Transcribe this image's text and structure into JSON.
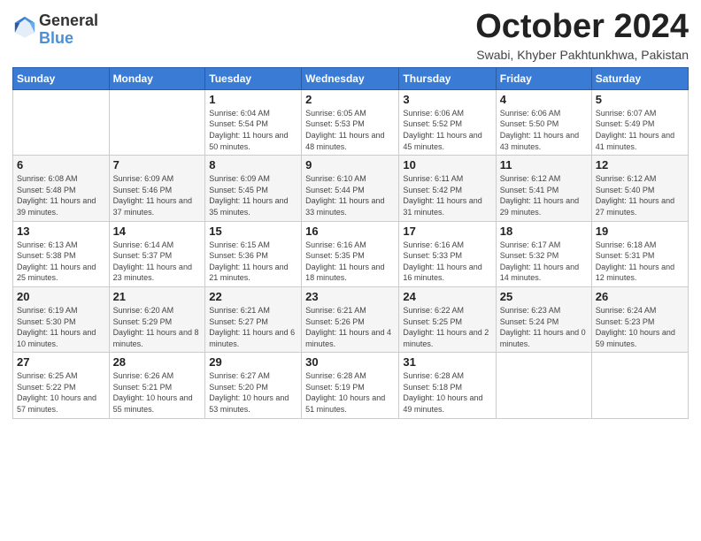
{
  "logo": {
    "general": "General",
    "blue": "Blue"
  },
  "header": {
    "month": "October 2024",
    "location": "Swabi, Khyber Pakhtunkhwa, Pakistan"
  },
  "weekdays": [
    "Sunday",
    "Monday",
    "Tuesday",
    "Wednesday",
    "Thursday",
    "Friday",
    "Saturday"
  ],
  "weeks": [
    [
      {
        "day": "",
        "info": ""
      },
      {
        "day": "",
        "info": ""
      },
      {
        "day": "1",
        "info": "Sunrise: 6:04 AM\nSunset: 5:54 PM\nDaylight: 11 hours and 50 minutes."
      },
      {
        "day": "2",
        "info": "Sunrise: 6:05 AM\nSunset: 5:53 PM\nDaylight: 11 hours and 48 minutes."
      },
      {
        "day": "3",
        "info": "Sunrise: 6:06 AM\nSunset: 5:52 PM\nDaylight: 11 hours and 45 minutes."
      },
      {
        "day": "4",
        "info": "Sunrise: 6:06 AM\nSunset: 5:50 PM\nDaylight: 11 hours and 43 minutes."
      },
      {
        "day": "5",
        "info": "Sunrise: 6:07 AM\nSunset: 5:49 PM\nDaylight: 11 hours and 41 minutes."
      }
    ],
    [
      {
        "day": "6",
        "info": "Sunrise: 6:08 AM\nSunset: 5:48 PM\nDaylight: 11 hours and 39 minutes."
      },
      {
        "day": "7",
        "info": "Sunrise: 6:09 AM\nSunset: 5:46 PM\nDaylight: 11 hours and 37 minutes."
      },
      {
        "day": "8",
        "info": "Sunrise: 6:09 AM\nSunset: 5:45 PM\nDaylight: 11 hours and 35 minutes."
      },
      {
        "day": "9",
        "info": "Sunrise: 6:10 AM\nSunset: 5:44 PM\nDaylight: 11 hours and 33 minutes."
      },
      {
        "day": "10",
        "info": "Sunrise: 6:11 AM\nSunset: 5:42 PM\nDaylight: 11 hours and 31 minutes."
      },
      {
        "day": "11",
        "info": "Sunrise: 6:12 AM\nSunset: 5:41 PM\nDaylight: 11 hours and 29 minutes."
      },
      {
        "day": "12",
        "info": "Sunrise: 6:12 AM\nSunset: 5:40 PM\nDaylight: 11 hours and 27 minutes."
      }
    ],
    [
      {
        "day": "13",
        "info": "Sunrise: 6:13 AM\nSunset: 5:38 PM\nDaylight: 11 hours and 25 minutes."
      },
      {
        "day": "14",
        "info": "Sunrise: 6:14 AM\nSunset: 5:37 PM\nDaylight: 11 hours and 23 minutes."
      },
      {
        "day": "15",
        "info": "Sunrise: 6:15 AM\nSunset: 5:36 PM\nDaylight: 11 hours and 21 minutes."
      },
      {
        "day": "16",
        "info": "Sunrise: 6:16 AM\nSunset: 5:35 PM\nDaylight: 11 hours and 18 minutes."
      },
      {
        "day": "17",
        "info": "Sunrise: 6:16 AM\nSunset: 5:33 PM\nDaylight: 11 hours and 16 minutes."
      },
      {
        "day": "18",
        "info": "Sunrise: 6:17 AM\nSunset: 5:32 PM\nDaylight: 11 hours and 14 minutes."
      },
      {
        "day": "19",
        "info": "Sunrise: 6:18 AM\nSunset: 5:31 PM\nDaylight: 11 hours and 12 minutes."
      }
    ],
    [
      {
        "day": "20",
        "info": "Sunrise: 6:19 AM\nSunset: 5:30 PM\nDaylight: 11 hours and 10 minutes."
      },
      {
        "day": "21",
        "info": "Sunrise: 6:20 AM\nSunset: 5:29 PM\nDaylight: 11 hours and 8 minutes."
      },
      {
        "day": "22",
        "info": "Sunrise: 6:21 AM\nSunset: 5:27 PM\nDaylight: 11 hours and 6 minutes."
      },
      {
        "day": "23",
        "info": "Sunrise: 6:21 AM\nSunset: 5:26 PM\nDaylight: 11 hours and 4 minutes."
      },
      {
        "day": "24",
        "info": "Sunrise: 6:22 AM\nSunset: 5:25 PM\nDaylight: 11 hours and 2 minutes."
      },
      {
        "day": "25",
        "info": "Sunrise: 6:23 AM\nSunset: 5:24 PM\nDaylight: 11 hours and 0 minutes."
      },
      {
        "day": "26",
        "info": "Sunrise: 6:24 AM\nSunset: 5:23 PM\nDaylight: 10 hours and 59 minutes."
      }
    ],
    [
      {
        "day": "27",
        "info": "Sunrise: 6:25 AM\nSunset: 5:22 PM\nDaylight: 10 hours and 57 minutes."
      },
      {
        "day": "28",
        "info": "Sunrise: 6:26 AM\nSunset: 5:21 PM\nDaylight: 10 hours and 55 minutes."
      },
      {
        "day": "29",
        "info": "Sunrise: 6:27 AM\nSunset: 5:20 PM\nDaylight: 10 hours and 53 minutes."
      },
      {
        "day": "30",
        "info": "Sunrise: 6:28 AM\nSunset: 5:19 PM\nDaylight: 10 hours and 51 minutes."
      },
      {
        "day": "31",
        "info": "Sunrise: 6:28 AM\nSunset: 5:18 PM\nDaylight: 10 hours and 49 minutes."
      },
      {
        "day": "",
        "info": ""
      },
      {
        "day": "",
        "info": ""
      }
    ]
  ]
}
